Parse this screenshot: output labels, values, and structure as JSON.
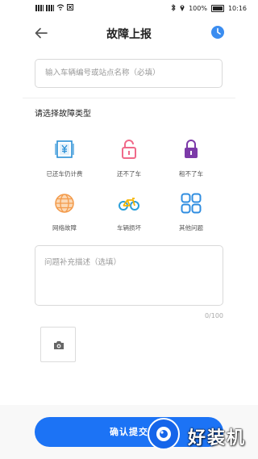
{
  "status_bar": {
    "battery": "100%",
    "time": "10:16"
  },
  "header": {
    "title": "故障上报",
    "back_icon": "arrow-left-icon",
    "history_icon": "clock-icon"
  },
  "search": {
    "placeholder": "输入车辆编号或站点名称（必填）"
  },
  "fault_section": {
    "title": "请选择故障类型",
    "items": [
      {
        "label": "已还车仍计费",
        "icon": "billing-icon",
        "color": "#2a8fd6"
      },
      {
        "label": "还不了车",
        "icon": "unlock-icon",
        "color": "#f06a8a"
      },
      {
        "label": "租不了车",
        "icon": "lock-icon",
        "color": "#7c3aa8"
      },
      {
        "label": "网络故障",
        "icon": "network-icon",
        "color": "#f39a4a"
      },
      {
        "label": "车辆损坏",
        "icon": "bicycle-icon",
        "color": "#2b9fd9"
      },
      {
        "label": "其他问题",
        "icon": "grid-icon",
        "color": "#2f8de0"
      }
    ]
  },
  "description": {
    "placeholder": "问题补充描述（选填）",
    "counter": "0/100"
  },
  "photo": {
    "icon": "camera-icon"
  },
  "confirm": {
    "label": "确认提交"
  },
  "watermark": {
    "text": "好装机"
  },
  "colors": {
    "primary": "#1c73f5"
  }
}
